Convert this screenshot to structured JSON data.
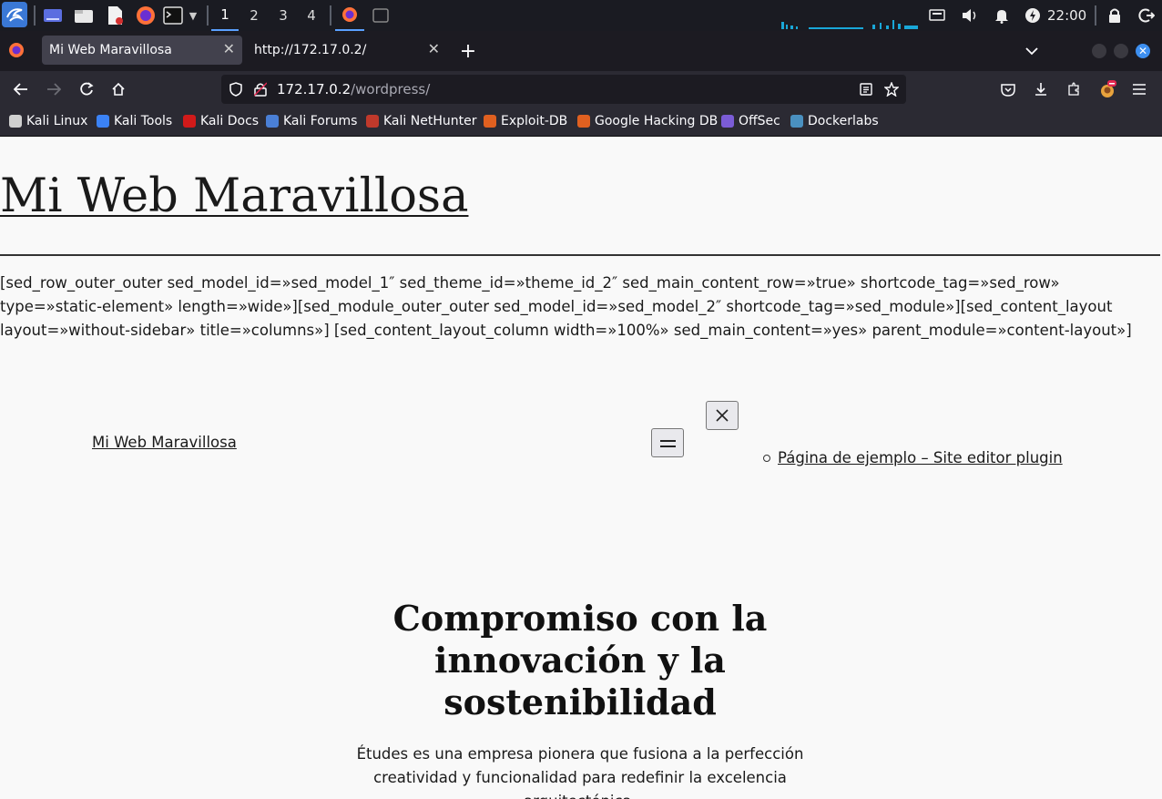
{
  "taskbar": {
    "workspaces": [
      "1",
      "2",
      "3",
      "4"
    ],
    "clock": "22:00"
  },
  "browser": {
    "tabs": [
      {
        "title": "Mi Web Maravillosa",
        "active": true
      },
      {
        "title": "http://172.17.0.2/",
        "active": false
      }
    ],
    "url_host": "172.17.0.2",
    "url_path": "/wordpress/",
    "bookmarks": [
      {
        "label": "Kali Linux",
        "color": "#d0d0d0"
      },
      {
        "label": "Kali Tools",
        "color": "#3b82f6"
      },
      {
        "label": "Kali Docs",
        "color": "#d11a1a"
      },
      {
        "label": "Kali Forums",
        "color": "#4a7fd6"
      },
      {
        "label": "Kali NetHunter",
        "color": "#c0392b"
      },
      {
        "label": "Exploit-DB",
        "color": "#e06020"
      },
      {
        "label": "Google Hacking DB",
        "color": "#e06020"
      },
      {
        "label": "OffSec",
        "color": "#7b5cd6"
      },
      {
        "label": "Dockerlabs",
        "color": "#4a90c0"
      }
    ]
  },
  "page": {
    "site_title": "Mi Web Maravillosa",
    "shortcode_text": "[sed_row_outer_outer sed_model_id=»sed_model_1″ sed_theme_id=»theme_id_2″ sed_main_content_row=»true» shortcode_tag=»sed_row» type=»static-element» length=»wide»][sed_module_outer_outer sed_model_id=»sed_model_2″ shortcode_tag=»sed_module»][sed_content_layout layout=»without-sidebar» title=»columns»] [sed_content_layout_column width=»100%» sed_main_content=»yes» parent_module=»content-layout»]",
    "inner_site_title": "Mi Web Maravillosa",
    "nav_link": "Página de ejemplo – Site editor plugin",
    "heading": "Compromiso con la innovación y la sostenibilidad",
    "lead": "Études es una empresa pionera que fusiona a la perfección creatividad y funcionalidad para redefinir la excelencia arquitectónica."
  }
}
